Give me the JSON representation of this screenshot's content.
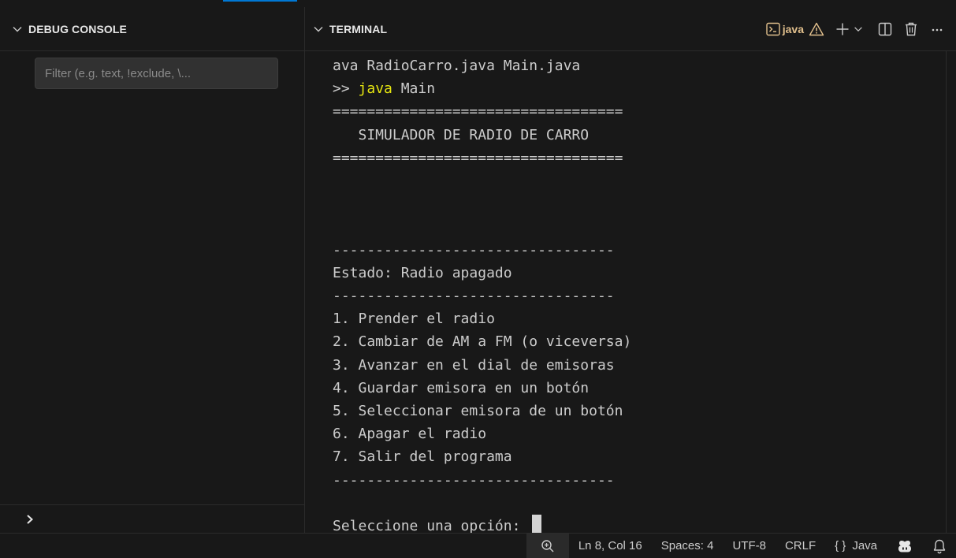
{
  "debug_console": {
    "title": "DEBUG CONSOLE",
    "filter_placeholder": "Filter (e.g. text, !exclude, \\..."
  },
  "terminal": {
    "title": "TERMINAL",
    "shell_label": "java",
    "icons": [
      "terminal-icon",
      "warning-icon",
      "add-icon",
      "chevron-down-icon",
      "split-icon",
      "trash-icon",
      "more-icon"
    ],
    "lines": [
      "ava RadioCarro.java Main.java",
      "==================================",
      "   SIMULADOR DE RADIO DE CARRO",
      "==================================",
      "",
      "",
      "",
      "---------------------------------",
      "Estado: Radio apagado",
      "---------------------------------",
      "1. Prender el radio",
      "2. Cambiar de AM a FM (o viceversa)",
      "3. Avanzar en el dial de emisoras",
      "4. Guardar emisora en un botón",
      "5. Seleccionar emisora de un botón",
      "6. Apagar el radio",
      "7. Salir del programa",
      "---------------------------------",
      "",
      "Seleccione una opción: "
    ],
    "prompt_prefix": ">> ",
    "prompt_keyword": "java",
    "prompt_arg": " Main"
  },
  "statusbar": {
    "position": "Ln 8, Col 16",
    "spaces": "Spaces: 4",
    "encoding": "UTF-8",
    "eol": "CRLF",
    "language": "Java",
    "language_braces": "{ }"
  },
  "colors": {
    "background": "#181818",
    "warning": "#e2c08d",
    "keyword": "#e5e510",
    "accent": "#0078d4"
  }
}
